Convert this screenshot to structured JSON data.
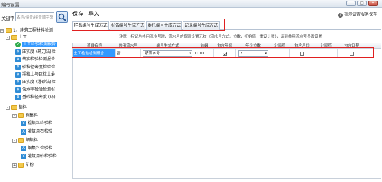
{
  "window": {
    "title": "编号设置"
  },
  "left": {
    "keyword_label": "关键字",
    "search_placeholder": "名称/拼音/拼音首字母",
    "tree": {
      "root": "1、建筑工程材料检测",
      "soil": "土工",
      "soil_items": [
        "土工检验检测报告",
        "压实度 (环刀法)检",
        "击实检验检测报告",
        "砂粒径密度检验检",
        "粗粒土与巨粒土最",
        "压实度 (灌砂法)检",
        "含水率检验检测报",
        "基砂粒径密度 (环)"
      ],
      "aggregate": "集料",
      "coarse": "粗集料",
      "coarse_items": [
        "粗集料检验检",
        "灌筑用石检验"
      ],
      "fine": "细集料",
      "fine_items": [
        "细集料检验检",
        "灌筑用砂检验检"
      ],
      "mineral": "矿粉"
    }
  },
  "right": {
    "menu": [
      "保存",
      "导入"
    ],
    "tip": "指示设置服务保存",
    "tabs": [
      "样品编号生成方式",
      "报告编号生成方式",
      "委托编号生成方式",
      "记录编号生成方式"
    ],
    "note": "注意：标记为共用流水号时，流水号的规则设置无效（流水号方式，位数，初始值，重设计数），请到共用流水号界面设置",
    "columns": [
      "项目名称",
      "共用流水号",
      "编号生成方式",
      "前缀",
      "包含年份",
      "年份位数",
      "分隔符",
      "包含月份",
      "分隔符",
      "包含日期"
    ],
    "row": {
      "name": "土工检验检测报告",
      "shared_serial": "否",
      "gen_method": "按流水号",
      "prefix": "0101",
      "include_year": true,
      "year_digits": "2",
      "separator1": "",
      "include_month": false,
      "separator2": "",
      "include_day": false
    }
  }
}
